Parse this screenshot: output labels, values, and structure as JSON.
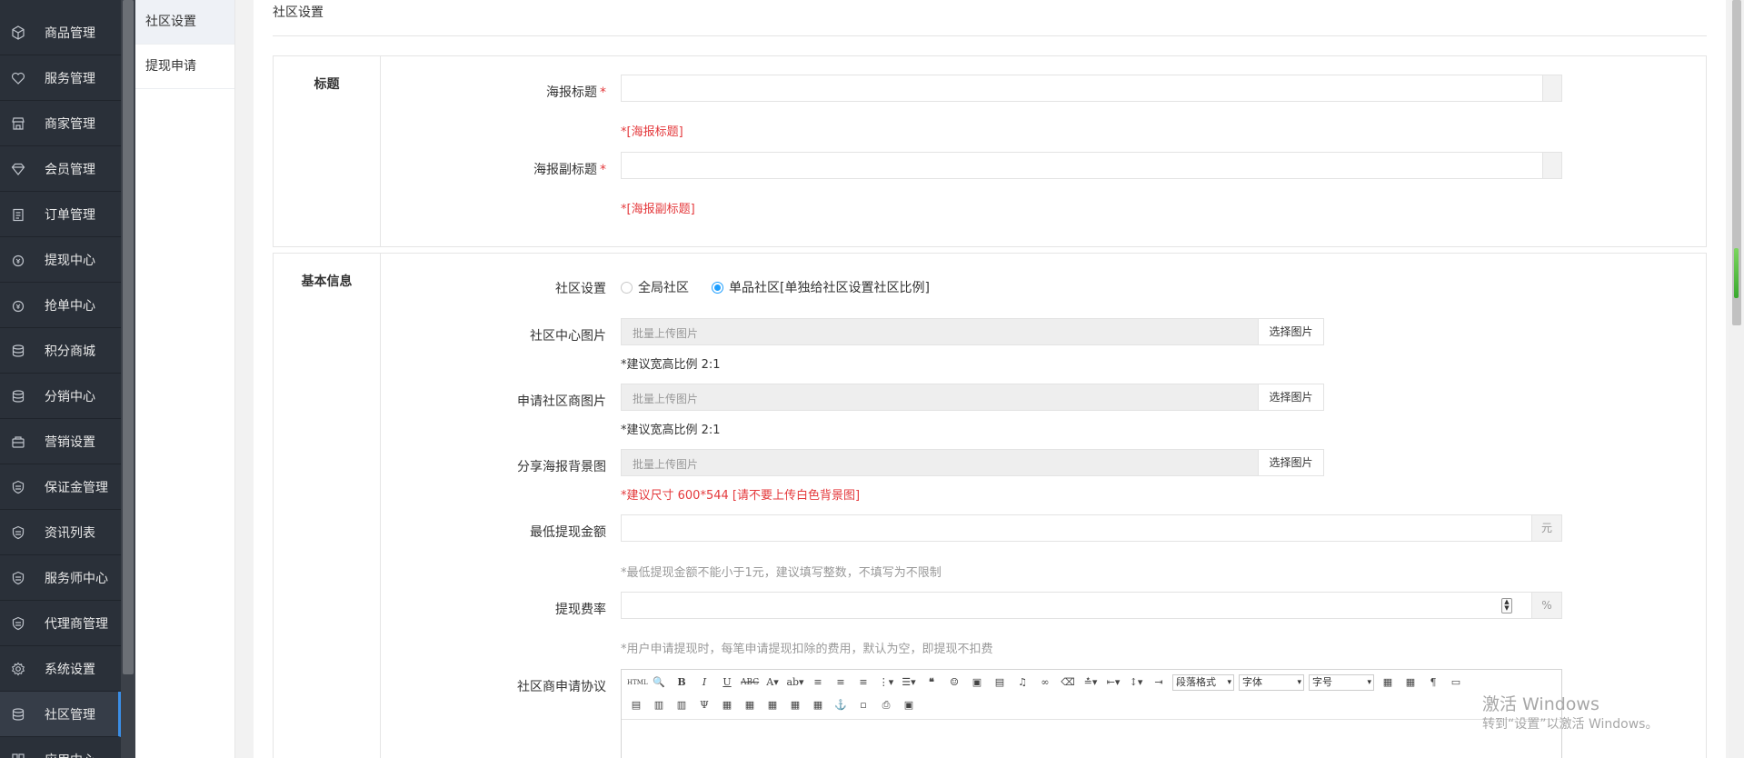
{
  "sidebar": {
    "items": [
      {
        "label": "商品管理",
        "icon": "cube-icon"
      },
      {
        "label": "服务管理",
        "icon": "heart-icon"
      },
      {
        "label": "商家管理",
        "icon": "store-icon"
      },
      {
        "label": "会员管理",
        "icon": "diamond-icon"
      },
      {
        "label": "订单管理",
        "icon": "clipboard-icon"
      },
      {
        "label": "提现中心",
        "icon": "coin-icon"
      },
      {
        "label": "抢单中心",
        "icon": "coin-icon"
      },
      {
        "label": "积分商城",
        "icon": "database-icon"
      },
      {
        "label": "分销中心",
        "icon": "database-icon"
      },
      {
        "label": "营销设置",
        "icon": "gift-icon"
      },
      {
        "label": "保证金管理",
        "icon": "shield-icon"
      },
      {
        "label": "资讯列表",
        "icon": "shield-icon"
      },
      {
        "label": "服务师中心",
        "icon": "shield-icon"
      },
      {
        "label": "代理商管理",
        "icon": "shield-icon"
      },
      {
        "label": "系统设置",
        "icon": "gear-icon"
      },
      {
        "label": "社区管理",
        "icon": "database-icon"
      },
      {
        "label": "应用中心",
        "icon": "grid-icon"
      }
    ],
    "active_index": 15
  },
  "subnav": {
    "items": [
      "社区设置",
      "提现申请"
    ],
    "active_index": 0
  },
  "page": {
    "title": "社区设置"
  },
  "section_title": {
    "label": "标题",
    "poster_title_label": "海报标题",
    "poster_title_value": "",
    "poster_title_hint": "*[海报标题]",
    "poster_subtitle_label": "海报副标题",
    "poster_subtitle_value": "",
    "poster_subtitle_hint": "*[海报副标题]",
    "required_mark": "*"
  },
  "section_basic": {
    "label": "基本信息",
    "community_setting_label": "社区设置",
    "radio_global": "全局社区",
    "radio_single": "单品社区[单独给社区设置社区比例]",
    "radio_selected": "single",
    "center_image_label": "社区中心图片",
    "center_image_placeholder": "批量上传图片",
    "center_image_button": "选择图片",
    "center_image_hint": "*建议宽高比例 2:1",
    "apply_image_label": "申请社区商图片",
    "apply_image_placeholder": "批量上传图片",
    "apply_image_button": "选择图片",
    "apply_image_hint": "*建议宽高比例 2:1",
    "share_bg_label": "分享海报背景图",
    "share_bg_placeholder": "批量上传图片",
    "share_bg_button": "选择图片",
    "share_bg_hint": "*建议尺寸 600*544 [请不要上传白色背景图]",
    "min_withdraw_label": "最低提现金额",
    "min_withdraw_value": "",
    "min_withdraw_unit": "元",
    "min_withdraw_hint": "*最低提现金额不能小于1元，建议填写整数，不填写为不限制",
    "fee_rate_label": "提现费率",
    "fee_rate_value": "",
    "fee_rate_unit": "%",
    "fee_rate_hint": "*用户申请提现时，每笔申请提现扣除的费用，默认为空，即提现不扣费",
    "agreement_label": "社区商申请协议"
  },
  "editor": {
    "paragraph_format": "段落格式",
    "font_family": "字体",
    "font_size": "字号",
    "html_btn": "HTML"
  },
  "watermark": {
    "line1": "激活 Windows",
    "line2": "转到“设置”以激活 Windows。"
  }
}
